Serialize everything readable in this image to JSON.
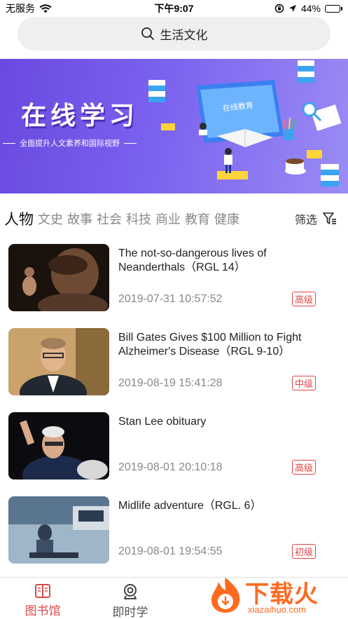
{
  "status_bar": {
    "carrier": "无服务",
    "time": "下午9:07",
    "battery": "44%",
    "battery_level": 0.44
  },
  "search": {
    "label": "生活文化"
  },
  "banner": {
    "title": "在线学习",
    "subtitle": "全面提升人文素养和国际视野",
    "screen_text": "在线教育"
  },
  "categories": {
    "tabs": [
      "人物",
      "文史",
      "故事",
      "社会",
      "科技",
      "商业",
      "教育",
      "健康"
    ],
    "active_index": 0,
    "filter_label": "筛选"
  },
  "articles": [
    {
      "title": "The not-so-dangerous lives of Neanderthals（RGL 14）",
      "date": "2019-07-31 10:57:52",
      "level": "高级"
    },
    {
      "title": "Bill Gates Gives $100 Million to Fight Alzheimer's Disease（RGL 9-10）",
      "date": "2019-08-19 15:41:28",
      "level": "中级"
    },
    {
      "title": "Stan Lee obituary",
      "date": "2019-08-01 20:10:18",
      "level": "高级"
    },
    {
      "title": "Midlife adventure（RGL. 6）",
      "date": "2019-08-01 19:54:55",
      "level": "初级"
    }
  ],
  "tab_bar": {
    "items": [
      {
        "label": "图书馆",
        "icon": "book-icon",
        "active": true
      },
      {
        "label": "即时学",
        "icon": "webcam-icon",
        "active": false
      }
    ]
  },
  "watermark": {
    "text_cn": "下载火",
    "text_en": "xiazaihuo.com"
  },
  "colors": {
    "accent": "#d94a4a",
    "badge": "#e04545",
    "banner_purple": "#6a49e0",
    "watermark": "#ff6a1f"
  }
}
